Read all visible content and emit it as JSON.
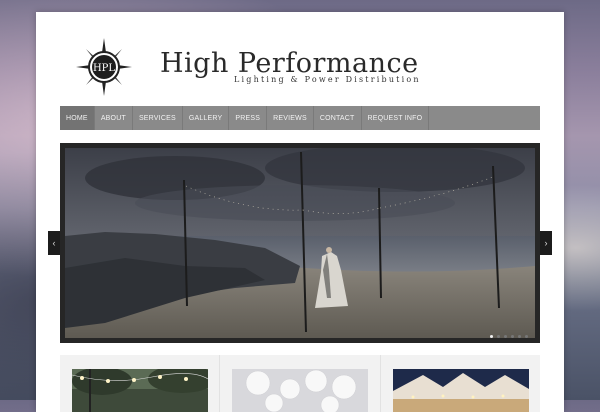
{
  "brand": {
    "emblem_text": "HPL",
    "title": "High Performance",
    "subtitle": "Lighting & Power Distribution"
  },
  "nav": {
    "items": [
      {
        "label": "Home",
        "active": true
      },
      {
        "label": "About",
        "active": false
      },
      {
        "label": "Services",
        "active": false
      },
      {
        "label": "Gallery",
        "active": false
      },
      {
        "label": "Press",
        "active": false
      },
      {
        "label": "Reviews",
        "active": false
      },
      {
        "label": "Contact",
        "active": false
      },
      {
        "label": "Request Info",
        "active": false
      }
    ]
  },
  "slider": {
    "prev_icon": "chevron-left-icon",
    "next_icon": "chevron-right-icon",
    "prev_glyph": "‹",
    "next_glyph": "›",
    "slide_count": 6,
    "active_index": 0
  },
  "thumbnails": [
    {
      "icon": "string-lights-photo"
    },
    {
      "icon": "paper-lanterns-photo"
    },
    {
      "icon": "tent-photo"
    }
  ],
  "colors": {
    "nav_bg": "#8a8a8a",
    "nav_active": "#737373",
    "slider_frame": "#262626"
  }
}
